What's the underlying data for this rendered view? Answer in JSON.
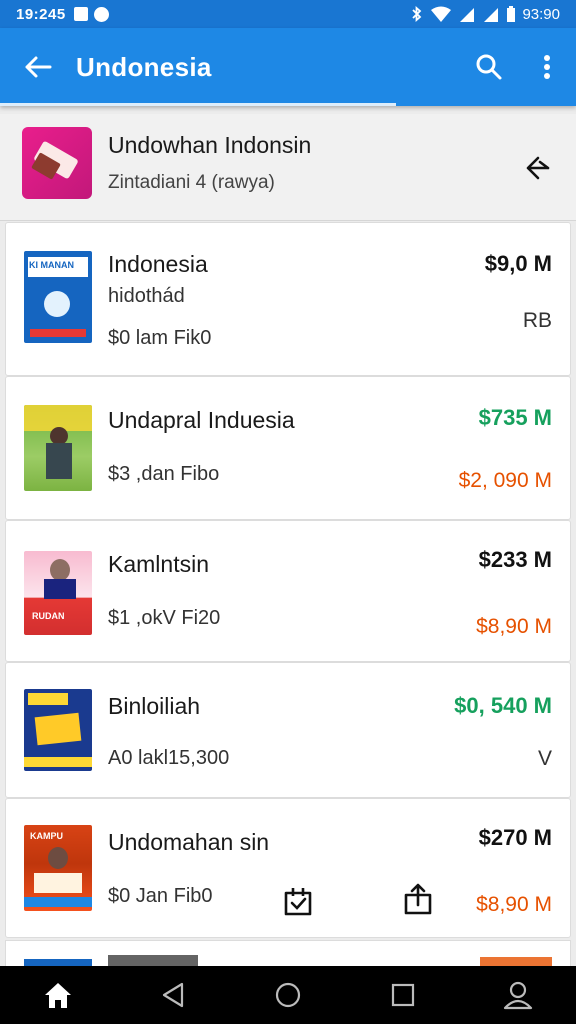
{
  "status_bar": {
    "time": "19:245",
    "clock": "93:90"
  },
  "app_bar": {
    "title": "Undonesia",
    "back_icon": "arrow-left-icon",
    "search_icon": "search-icon",
    "more_icon": "more-vert-icon"
  },
  "header": {
    "name": "Undowhan Indonsin",
    "subtitle": "Zintadiani 4 (rawya)"
  },
  "items": [
    {
      "title": "Indonesia",
      "sub1": "hidothád",
      "sub2": "$0 lam Fik0",
      "price": "$9,0 M",
      "price2": "RB",
      "price_color": "#111111",
      "price2_color": "#333333"
    },
    {
      "title": "Undapral Induesia",
      "sub1": "$3 ,dan Fibo",
      "price": "$735 M",
      "price2": "$2, 090 M",
      "price_color": "#16a05d",
      "price2_color": "#e65100"
    },
    {
      "title": "Kamlntsin",
      "sub1": "$1 ,okV Fi20",
      "price": "$233 M",
      "price2": "$8,90 M",
      "price_color": "#111111",
      "price2_color": "#e65100"
    },
    {
      "title": "Binloiliah",
      "sub1": "A0 lakl15,300",
      "price": "$0, 540 M",
      "price2": "V",
      "price_color": "#16a05d",
      "price2_color": "#333333"
    },
    {
      "title": "Undomahan sin",
      "sub1": "$0 Jan Fib0",
      "price": "$270 M",
      "price2": "$8,90 M",
      "price_color": "#111111",
      "price2_color": "#e65100"
    }
  ],
  "cover_labels": {
    "a": "KI MANAN",
    "c": "RUDAN",
    "e": "KAMPU"
  }
}
